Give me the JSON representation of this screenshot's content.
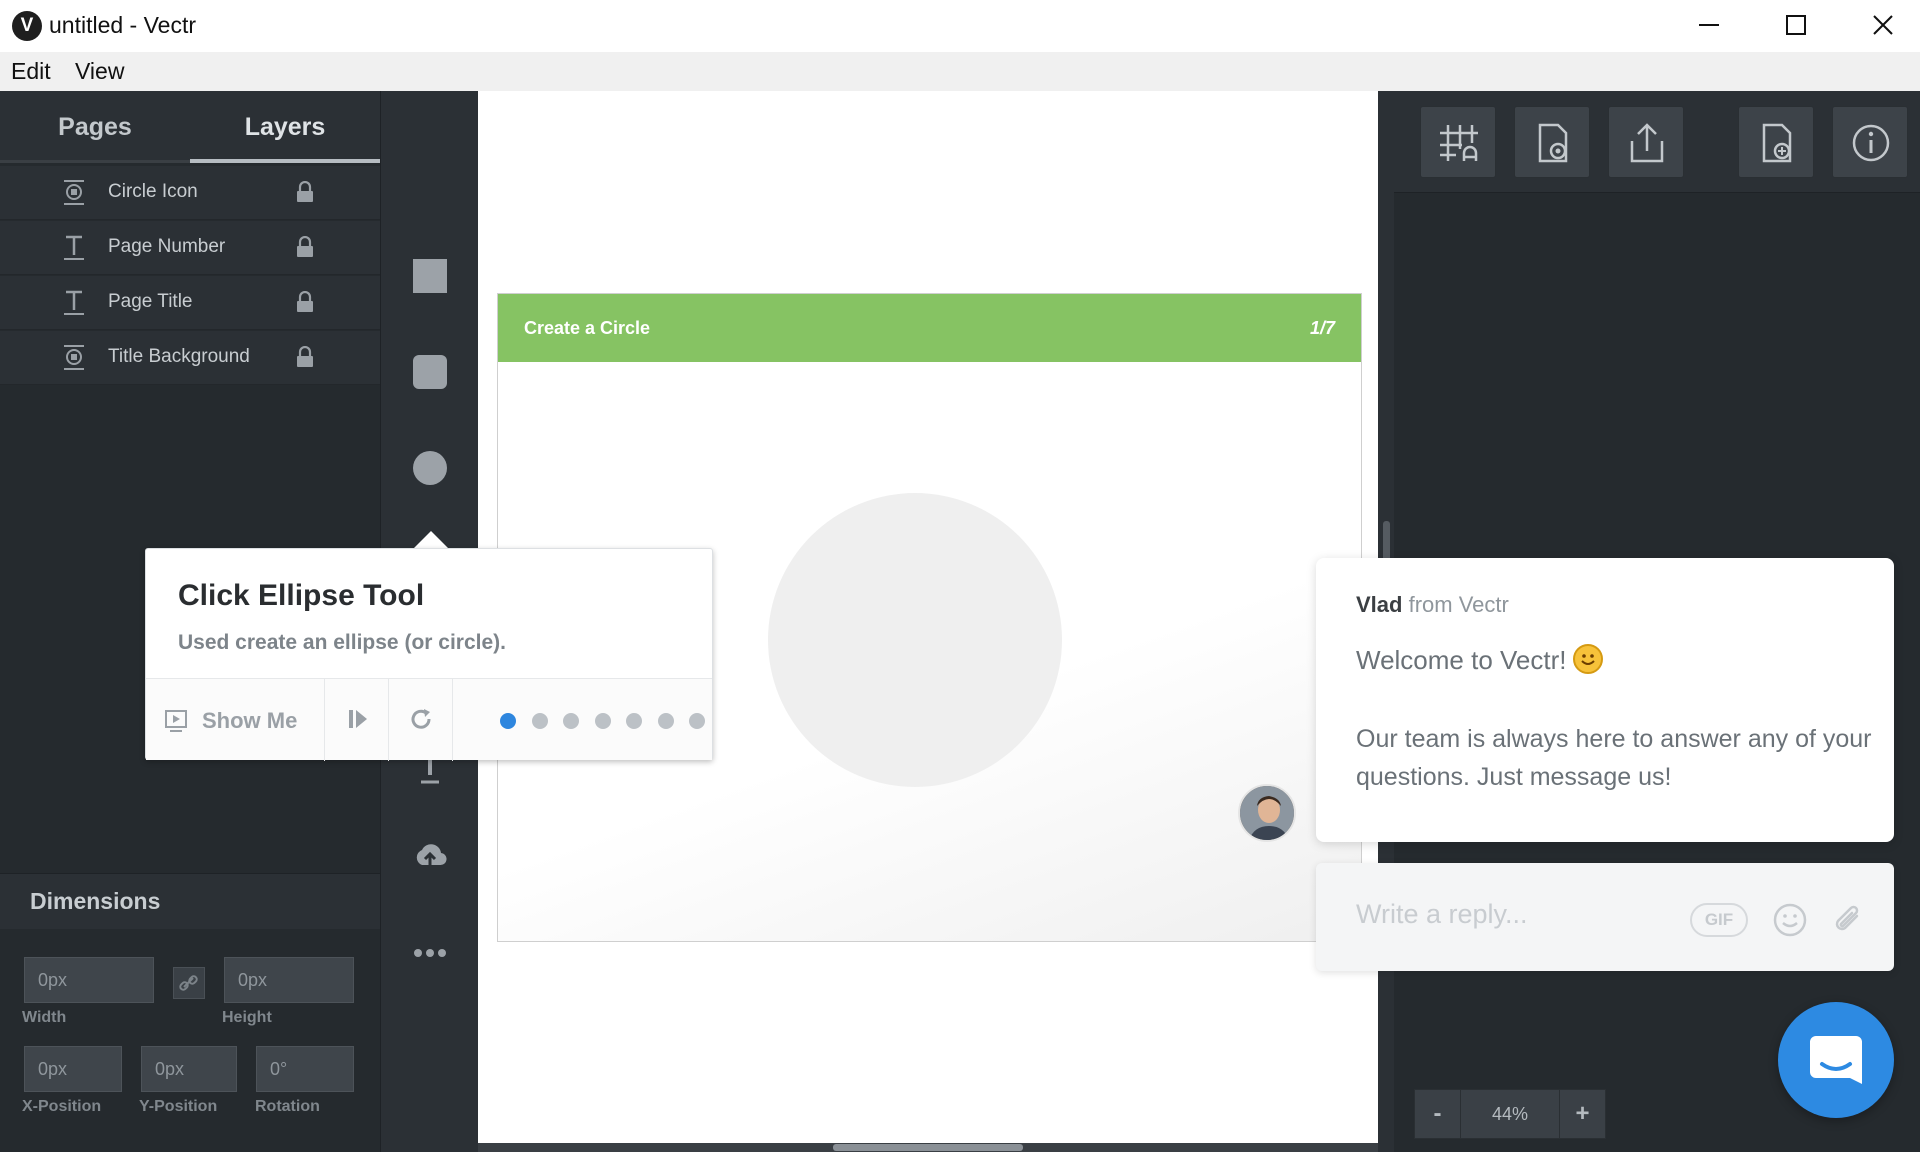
{
  "window": {
    "title": "untitled - Vectr",
    "logo_letter": "V"
  },
  "menu": {
    "edit": "Edit",
    "view": "View"
  },
  "left_panel": {
    "tabs": [
      {
        "label": "Pages"
      },
      {
        "label": "Layers"
      }
    ],
    "active_tab": "Layers",
    "layers": [
      {
        "label": "Circle Icon",
        "icon": "group-icon"
      },
      {
        "label": "Page Number",
        "icon": "text-icon"
      },
      {
        "label": "Page Title",
        "icon": "text-icon"
      },
      {
        "label": "Title Background",
        "icon": "group-icon"
      }
    ],
    "dimensions": {
      "title": "Dimensions",
      "width": {
        "value": "0px",
        "label": "Width"
      },
      "height": {
        "value": "0px",
        "label": "Height"
      },
      "x": {
        "value": "0px",
        "label": "X-Position"
      },
      "y": {
        "value": "0px",
        "label": "Y-Position"
      },
      "rotation": {
        "value": "0°",
        "label": "Rotation"
      }
    }
  },
  "tools": [
    "rectangle-tool-icon",
    "rounded-rectangle-tool-icon",
    "ellipse-tool-icon",
    "text-tool-icon",
    "upload-icon",
    "more-icon"
  ],
  "artboard": {
    "title": "Create a Circle",
    "page_number": "1/7",
    "header_color": "#86c363"
  },
  "tooltip": {
    "title": "Click Ellipse Tool",
    "subtitle": "Used create an ellipse (or circle).",
    "show_me": "Show Me",
    "step_count": 7,
    "active_step": 1
  },
  "right_panel": {
    "toolbar": [
      "grid-snap-icon",
      "page-settings-icon",
      "export-icon",
      "add-page-icon",
      "info-icon"
    ],
    "zoom": {
      "minus": "-",
      "value": "44%",
      "plus": "+"
    }
  },
  "chat": {
    "sender_name": "Vlad",
    "sender_org": "from Vectr",
    "greeting": "Welcome to Vectr!",
    "message": "Our team is always here to answer any of your questions. Just message us!",
    "reply_placeholder": "Write a reply...",
    "gif_label": "GIF",
    "accent_color": "#2d8ae2"
  }
}
